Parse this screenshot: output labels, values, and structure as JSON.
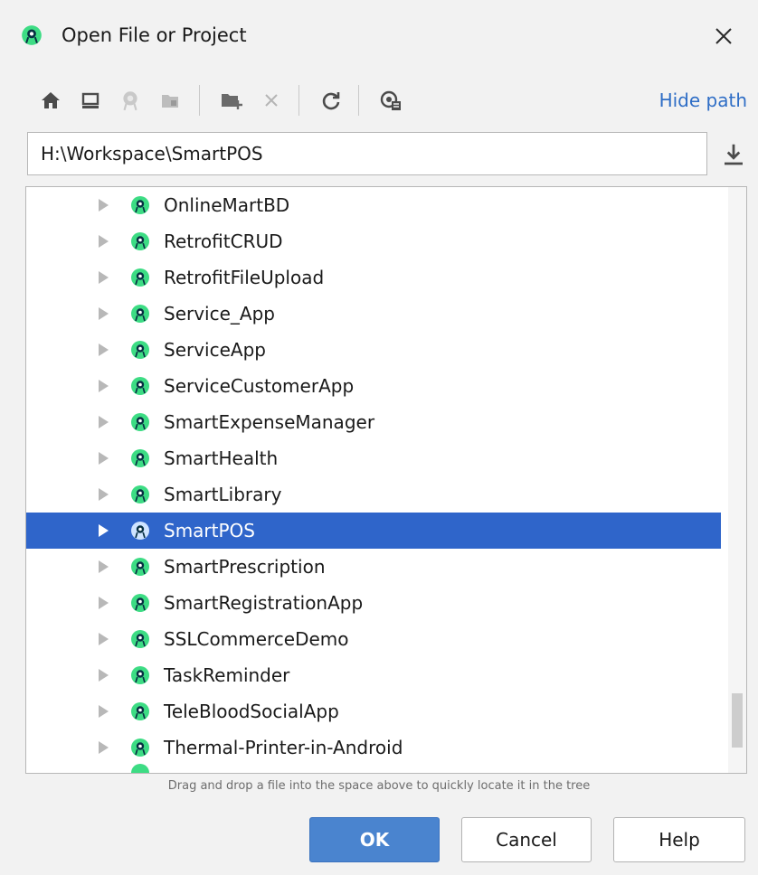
{
  "dialog": {
    "title": "Open File or Project",
    "title_icon": "android-studio-icon",
    "close_icon": "close-icon"
  },
  "toolbar": {
    "icons": [
      "home-icon",
      "desktop-icon",
      "project-directory-icon",
      "module-icon",
      "new-folder-icon",
      "delete-icon",
      "refresh-icon",
      "show-hidden-icon"
    ],
    "hide_path_label": "Hide path"
  },
  "path": {
    "value": "H:\\Workspace\\SmartPOS",
    "download_icon": "download-icon"
  },
  "tree": {
    "items": [
      {
        "label": "OnlineMartBD",
        "selected": false
      },
      {
        "label": "RetrofitCRUD",
        "selected": false
      },
      {
        "label": "RetrofitFileUpload",
        "selected": false
      },
      {
        "label": "Service_App",
        "selected": false
      },
      {
        "label": "ServiceApp",
        "selected": false
      },
      {
        "label": "ServiceCustomerApp",
        "selected": false
      },
      {
        "label": "SmartExpenseManager",
        "selected": false
      },
      {
        "label": "SmartHealth",
        "selected": false
      },
      {
        "label": "SmartLibrary",
        "selected": false
      },
      {
        "label": "SmartPOS",
        "selected": true
      },
      {
        "label": "SmartPrescription",
        "selected": false
      },
      {
        "label": "SmartRegistrationApp",
        "selected": false
      },
      {
        "label": "SSLCommerceDemo",
        "selected": false
      },
      {
        "label": "TaskReminder",
        "selected": false
      },
      {
        "label": "TeleBloodSocialApp",
        "selected": false
      },
      {
        "label": "Thermal-Printer-in-Android",
        "selected": false
      }
    ]
  },
  "hint": "Drag and drop a file into the space above to quickly locate it in the tree",
  "buttons": {
    "ok": "OK",
    "cancel": "Cancel",
    "help": "Help"
  },
  "colors": {
    "accent": "#2f65ca",
    "link": "#2f6ec6",
    "project_icon": "#3ddc84",
    "ok_button": "#4a84cf"
  }
}
